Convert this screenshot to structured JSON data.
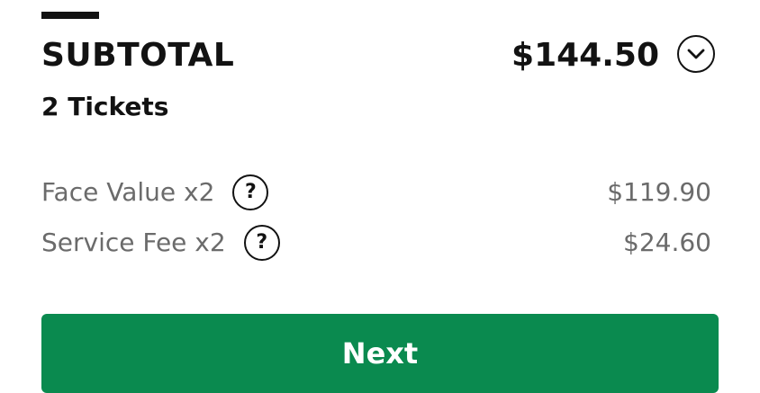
{
  "summary": {
    "title": "SUBTOTAL",
    "total": "$144.50",
    "tickets": "2 Tickets",
    "toggle_icon": "chevron-down-icon"
  },
  "fees": [
    {
      "label": "Face Value x2",
      "value": "$119.90",
      "help_icon": "?"
    },
    {
      "label": "Service Fee x2",
      "value": "$24.60",
      "help_icon": "?"
    }
  ],
  "actions": {
    "next_label": "Next"
  },
  "colors": {
    "text": "#121212",
    "muted": "#6b6b6b",
    "primary": "#0a8a4f"
  }
}
